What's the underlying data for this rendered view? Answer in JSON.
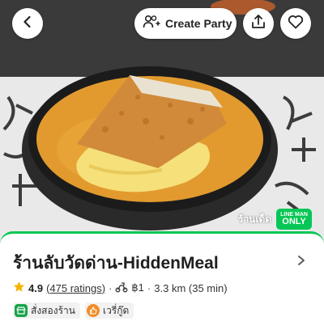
{
  "header": {
    "party_button": "Create Party"
  },
  "hero": {
    "badge_label": "ร้านเด็ด",
    "lineman_badge_top": "LINE MAN",
    "lineman_badge_bottom": "ONLY"
  },
  "restaurant": {
    "name": "ร้านลับวัดด่าน-HiddenMeal",
    "rating": "4.9",
    "rating_count": "(475 ratings)",
    "price_level": "฿1",
    "distance": "3.3 km (35 min)"
  },
  "tags": [
    {
      "label": "สั่งสองร้าน",
      "icon": "store-icon"
    },
    {
      "label": "เวรี่กู๊ด",
      "icon": "thumb-icon"
    }
  ],
  "colors": {
    "brand_green": "#06c755",
    "star": "#f5b400",
    "curry": "#e59a2a"
  }
}
